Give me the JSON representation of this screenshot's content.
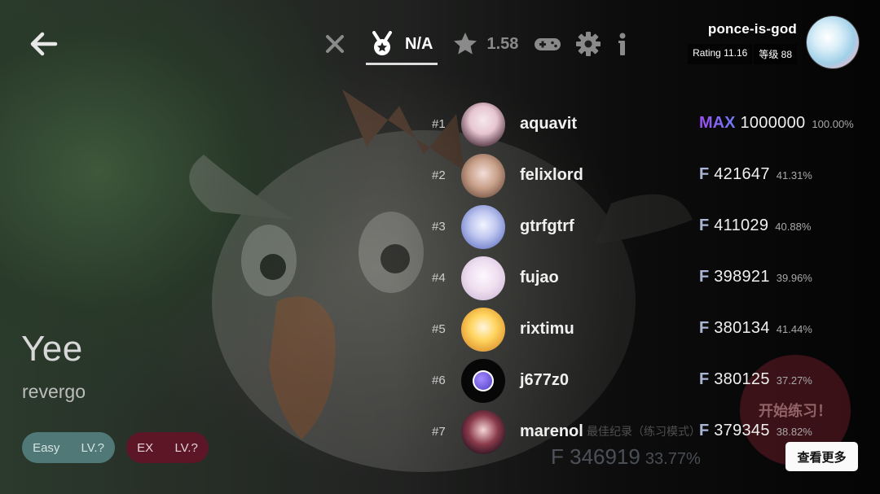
{
  "toolbar": {
    "rank_tab_label": "N/A",
    "rating_value": "1.58",
    "icons": [
      "close-icon",
      "medal-icon",
      "star-icon",
      "gamepad-icon",
      "gear-icon",
      "info-icon"
    ]
  },
  "user": {
    "name": "ponce-is-god",
    "rating": "Rating 11.16",
    "level": "等级 88"
  },
  "song": {
    "title": "Yee",
    "artist": "revergo"
  },
  "difficulties": [
    {
      "name": "Easy",
      "level": "LV.?",
      "color": "#4f7877"
    },
    {
      "name": "EX",
      "level": "LV.?",
      "color": "#5d1626"
    }
  ],
  "leaderboard": [
    {
      "rank": "#1",
      "name": "aquavit",
      "grade": "MAX",
      "score": "1000000",
      "accuracy": "100.00%"
    },
    {
      "rank": "#2",
      "name": "felixlord",
      "grade": "F",
      "score": "421647",
      "accuracy": "41.31%"
    },
    {
      "rank": "#3",
      "name": "gtrfgtrf",
      "grade": "F",
      "score": "411029",
      "accuracy": "40.88%"
    },
    {
      "rank": "#4",
      "name": "fujao",
      "grade": "F",
      "score": "398921",
      "accuracy": "39.96%"
    },
    {
      "rank": "#5",
      "name": "rixtimu",
      "grade": "F",
      "score": "380134",
      "accuracy": "41.44%"
    },
    {
      "rank": "#6",
      "name": "j677z0",
      "grade": "F",
      "score": "380125",
      "accuracy": "37.27%"
    },
    {
      "rank": "#7",
      "name": "marenol",
      "grade": "F",
      "score": "379345",
      "accuracy": "38.82%"
    }
  ],
  "personal_best": {
    "label": "最佳纪录（练习模式）",
    "grade": "F",
    "score": "346919",
    "accuracy": "33.77%"
  },
  "practice_button": "开始练习！",
  "view_more_label": "查看更多",
  "colors": {
    "max_grade": "#9c4ef0",
    "grade_f": "#aab6d6",
    "easy": "#4f7877",
    "ex": "#5d1626"
  }
}
